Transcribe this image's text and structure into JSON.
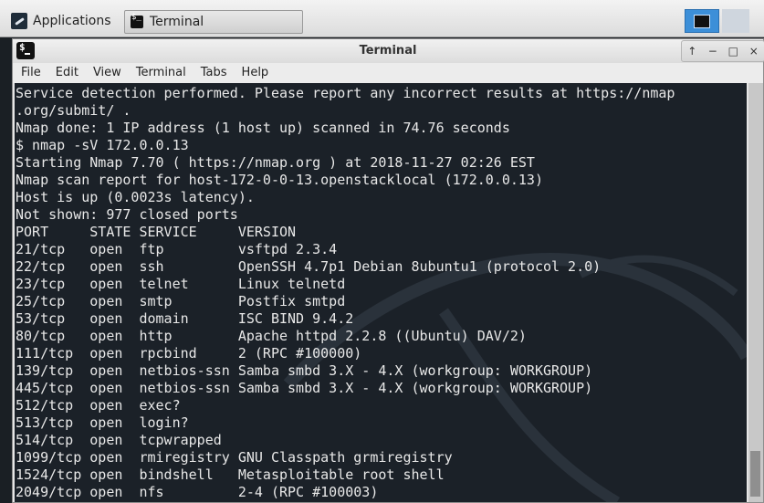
{
  "taskbar": {
    "applications_label": "Applications",
    "terminal_task_label": "Terminal"
  },
  "window": {
    "title": "Terminal",
    "controls": [
      "↑",
      "−",
      "□",
      "×"
    ],
    "menu": [
      "File",
      "Edit",
      "View",
      "Terminal",
      "Tabs",
      "Help"
    ]
  },
  "terminal": {
    "lines": [
      "Service detection performed. Please report any incorrect results at https://nmap",
      ".org/submit/ .",
      "Nmap done: 1 IP address (1 host up) scanned in 74.76 seconds",
      "$ nmap -sV 172.0.0.13",
      "Starting Nmap 7.70 ( https://nmap.org ) at 2018-11-27 02:26 EST",
      "Nmap scan report for host-172-0-0-13.openstacklocal (172.0.0.13)",
      "Host is up (0.0023s latency).",
      "Not shown: 977 closed ports",
      "PORT     STATE SERVICE     VERSION",
      "21/tcp   open  ftp         vsftpd 2.3.4",
      "22/tcp   open  ssh         OpenSSH 4.7p1 Debian 8ubuntu1 (protocol 2.0)",
      "23/tcp   open  telnet      Linux telnetd",
      "25/tcp   open  smtp        Postfix smtpd",
      "53/tcp   open  domain      ISC BIND 9.4.2",
      "80/tcp   open  http        Apache httpd 2.2.8 ((Ubuntu) DAV/2)",
      "111/tcp  open  rpcbind     2 (RPC #100000)",
      "139/tcp  open  netbios-ssn Samba smbd 3.X - 4.X (workgroup: WORKGROUP)",
      "445/tcp  open  netbios-ssn Samba smbd 3.X - 4.X (workgroup: WORKGROUP)",
      "512/tcp  open  exec?",
      "513/tcp  open  login?",
      "514/tcp  open  tcpwrapped",
      "1099/tcp open  rmiregistry GNU Classpath grmiregistry",
      "1524/tcp open  bindshell   Metasploitable root shell",
      "2049/tcp open  nfs         2-4 (RPC #100003)"
    ]
  }
}
